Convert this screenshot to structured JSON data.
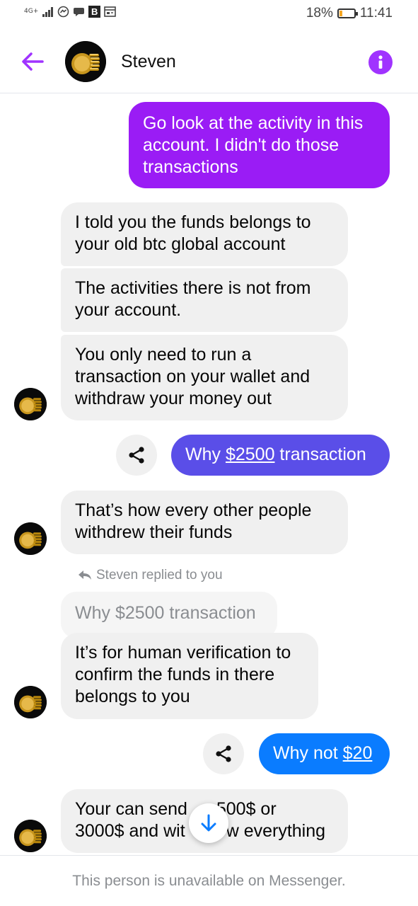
{
  "status_bar": {
    "network": "4G+",
    "battery_percent": "18%",
    "battery_level": 0.18,
    "time": "11:41",
    "b_badge": "B",
    "icons": [
      "signal-icon",
      "messenger-icon",
      "chat-icon",
      "b-app-icon",
      "news-icon",
      "battery-icon"
    ]
  },
  "header": {
    "contact_name": "Steven",
    "back_icon": "arrow-left-icon",
    "info_icon": "info-icon",
    "accent": "#a033ff"
  },
  "messages": [
    {
      "from": "me",
      "text": "Go look at the activity in this account. I didn't do those transactions",
      "color": "#9a1cf5"
    },
    {
      "from": "them",
      "text": "I told you the funds belongs to your old btc global account"
    },
    {
      "from": "them",
      "text": "The activities there is not from your account."
    },
    {
      "from": "them",
      "text": "You only need to run a transaction on your wallet and withdraw your money out"
    },
    {
      "from": "me",
      "prefix": "Why ",
      "link": "$2500",
      "suffix": " transaction",
      "color": "#5a4ee8"
    },
    {
      "from": "them",
      "text": "That’s how every other people withdrew their funds"
    },
    {
      "from": "them",
      "reply_label": "Steven replied to you",
      "quote": "Why $2500 transaction",
      "text": "It’s for human verification to confirm the funds in there belongs to you"
    },
    {
      "from": "me",
      "prefix": "Why not ",
      "link": "$20",
      "suffix": "",
      "color": "#0a7cff"
    },
    {
      "from": "them",
      "line1": "Your can send ",
      "line1_end": "500$ or",
      "line2": "3000$ and wit",
      "line2_end": "w everything"
    }
  ],
  "footer": {
    "notice": "This person is unavailable on Messenger."
  }
}
